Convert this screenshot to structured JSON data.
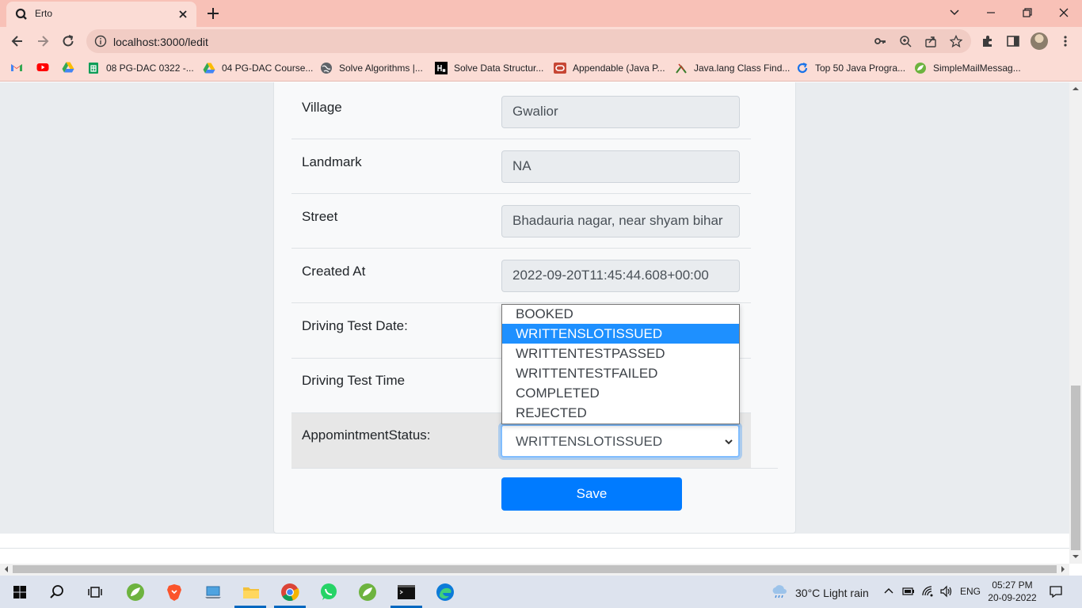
{
  "browser": {
    "tab_title": "Erto",
    "url": "localhost:3000/ledit",
    "bookmarks": [
      {
        "label": "08 PG-DAC 0322 -...",
        "icon": "google-sheets-icon"
      },
      {
        "label": "04 PG-DAC Course...",
        "icon": "google-drive-icon"
      },
      {
        "label": "Solve Algorithms |...",
        "icon": "globe-icon"
      },
      {
        "label": "Solve Data Structur...",
        "icon": "hackerrank-icon"
      },
      {
        "label": "Appendable (Java P...",
        "icon": "oracle-icon"
      },
      {
        "label": "Java.lang Class Find...",
        "icon": "java-icon"
      },
      {
        "label": "Top 50 Java Progra...",
        "icon": "refresh-icon"
      },
      {
        "label": "SimpleMailMessag...",
        "icon": "spring-icon"
      }
    ]
  },
  "form": {
    "rows": [
      {
        "label": "Village",
        "value": "Gwalior"
      },
      {
        "label": "Landmark",
        "value": "NA"
      },
      {
        "label": "Street",
        "value": "Bhadauria nagar, near shyam bihar"
      },
      {
        "label": "Created At",
        "value": "2022-09-20T11:45:44.608+00:00"
      }
    ],
    "driving_test_date_label": "Driving Test Date:",
    "driving_test_time_label": "Driving Test Time",
    "status_label": "AppomintmentStatus:",
    "status_value": "WRITTENSLOTISSUED",
    "status_options": [
      "BOOKED",
      "WRITTENSLOTISSUED",
      "WRITTENTESTPASSED",
      "WRITTENTESTFAILED",
      "COMPLETED",
      "REJECTED"
    ],
    "save_label": "Save"
  },
  "taskbar": {
    "weather": "30°C  Light rain",
    "language": "ENG",
    "time": "05:27 PM",
    "date": "20-09-2022"
  },
  "colors": {
    "chrome_tab_strip": "#f8c1b7",
    "chrome_toolbar": "#fbdcd5",
    "primary_button": "#007bff",
    "selected_option": "#1e90ff"
  }
}
